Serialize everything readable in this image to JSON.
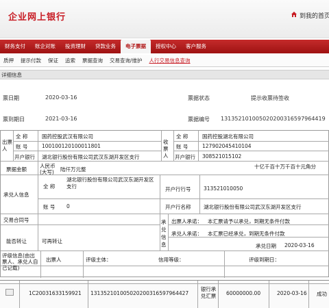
{
  "header": {
    "bank_name": "企业网上银行",
    "home_label": "到我的首页"
  },
  "nav": {
    "items": [
      {
        "label": "财务支付"
      },
      {
        "label": "账企对账"
      },
      {
        "label": "投资理财"
      },
      {
        "label": "贷款业务"
      },
      {
        "label": "电子票据",
        "active": true
      },
      {
        "label": "授权中心"
      },
      {
        "label": "客户服务"
      }
    ]
  },
  "subnav": {
    "items": [
      {
        "label": "质押"
      },
      {
        "label": "提示付款"
      },
      {
        "label": "保证"
      },
      {
        "label": "追索"
      },
      {
        "label": "票据查询"
      },
      {
        "label": "交易查询/维护"
      },
      {
        "label": "人行交易信息查询",
        "active": true
      }
    ]
  },
  "detail": {
    "section_title": "详细信息",
    "issue_date_label": "票日期",
    "issue_date": "2020-03-16",
    "status_label": "票据状态",
    "status": "提示收票待签收",
    "due_date_label": "票到期日",
    "due_date": "2021-03-16",
    "bill_no_label": "票据编号",
    "bill_no": "131352101005020200316597964419",
    "drawer_side_label": "出票人",
    "payee_side_label": "收票人",
    "full_name_label": "全  称",
    "account_label": "账  号",
    "bank_label": "开户银行",
    "drawer_name": "国药控股武汉有限公司",
    "drawer_account": "100100120100011801",
    "drawer_bank": "湖北银行股份有限公司武汉东湖开发区支行",
    "payee_name": "国药控股湖北有限公司",
    "payee_account": "127902045410104",
    "payee_bank_code": "308521015102",
    "amount_label": "票据金额",
    "amount_currency": "人民币",
    "amount_words": "陆仟万元整",
    "amount_case": "(大写)",
    "amount_units": "十亿千百十万千百十元角分",
    "acceptor_label": "承兑人信息",
    "acceptor_name_label": "全  称",
    "acceptor_name": "湖北银行股份有限公司武汉东湖开发区支行",
    "acceptor_account_label": "账  号",
    "acceptor_account": "0",
    "acceptor_bank_no_label": "开户行行号",
    "acceptor_bank_no": "313521010050",
    "acceptor_bank_name_label": "开户行名称",
    "acceptor_bank_name": "湖北银行股份有限公司武汉东湖开发区支行",
    "contract_label": "交易合同号",
    "transfer_label": "能否转让",
    "transfer_value": "可再转让",
    "accept_info_label": "承兑信息",
    "drawer_promise_label": "出票人承诺：",
    "drawer_promise": "本汇票请予以承兑，到期无条件付款",
    "acceptor_promise_label": "承兑人承诺：",
    "acceptor_promise": "本汇票已经承兑，到期无条件付款",
    "accept_date_label": "承兑日期",
    "accept_date": "2020-03-16",
    "rating_label": "评级信息(由出票人、承兑人自己记载)",
    "rating_drawer_label": "出票人",
    "rating_subject_label": "评级主体：",
    "credit_level_label": "信用等级：",
    "rating_due_label": "评级到期日："
  },
  "result_row": {
    "bill_id": "1C20031633159921",
    "bill_no": "131352101005020200316597964427",
    "bill_type": "银行承兑汇票",
    "amount": "60000000.00",
    "date": "2020-03-16",
    "status": "成功"
  },
  "colors": {
    "brand_red": "#c81c24",
    "nav_red": "#b01515"
  }
}
